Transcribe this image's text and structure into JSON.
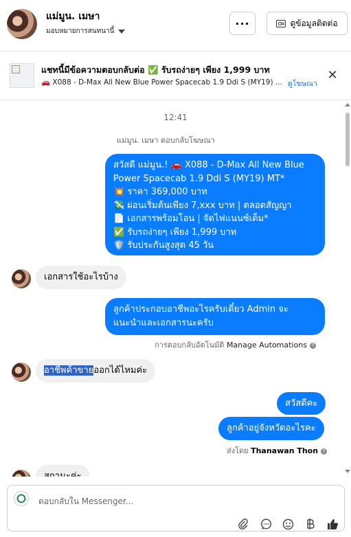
{
  "header": {
    "contact_name": "แม่มูน. เมษา",
    "assign_label": "มอบหมายการสนทนานี้",
    "more_label": "···",
    "contact_button_label": "ดูข้อมูลติดต่อ"
  },
  "ad_banner": {
    "title": "แชทนี้มีข้อความตอบกลับต่อ ✅ รับรถง่ายๆ เพียง 1,999 บาท",
    "subtitle": "🚗 X088 - D-Max All New Blue Power Spacecab 1.9 Ddi S (MY19) ...",
    "link": "ดูโฆษณา",
    "close_label": "✕"
  },
  "chat": {
    "timestamp": "12:41",
    "reply_note": "แม่มูน. เมษา ตอบกลับโฆษณา",
    "ad_reply_lines": [
      "สวัสดี แม่มูน.! 🚗 X088 - D-Max All New Blue",
      "Power Spacecab 1.9 Ddi S (MY19) MT*",
      "💥 ราคา 369,000 บาท",
      "💸 ผ่อนเริ่มต้นเพียง 7,xxx บาท | ตลอดสัญญา",
      "📄 เอกสารพร้อมโอน | จัดไฟแนนซ์เต็ม*",
      "✅ รับรถง่ายๆ เพียง 1,999 บาท",
      "🛡️ รับประกันสูงสุด 45 วัน"
    ],
    "msg_in_1": "เอกสารใช้อะไรบ้าง",
    "msg_out_2_lines": [
      "ลูกค้าประกอบอาชีพอะไรครับเดี๋ยว Admin จะ",
      "แนะนำและเอกสารนะครับ"
    ],
    "auto_note_prefix": "การตอบกลับอัตโนมัติ",
    "auto_note_link": "Manage Automations",
    "msg_in_3_highlight": "อาชีพค้าขาย",
    "msg_in_3_rest": "ออกได้ไหมค่ะ",
    "msg_out_4": "สวัสดีคะ",
    "msg_out_5": "ลูกค้าอยู่จังหวัดอะไรคะ",
    "sent_by_prefix": "ส่งโดย",
    "sent_by_name": "Thanawan Thon",
    "msg_in_6_partial": "สถานะค่ะ"
  },
  "composer": {
    "placeholder": "ตอบกลับใน Messenger...",
    "icons": [
      "paperclip-icon",
      "chat-bubble-icon",
      "emoji-icon",
      "baht-icon",
      "thumbs-up-icon"
    ]
  },
  "colors": {
    "outgoing": "#0a7cff",
    "incoming": "#f0f0f0",
    "link": "#1b74e4"
  }
}
